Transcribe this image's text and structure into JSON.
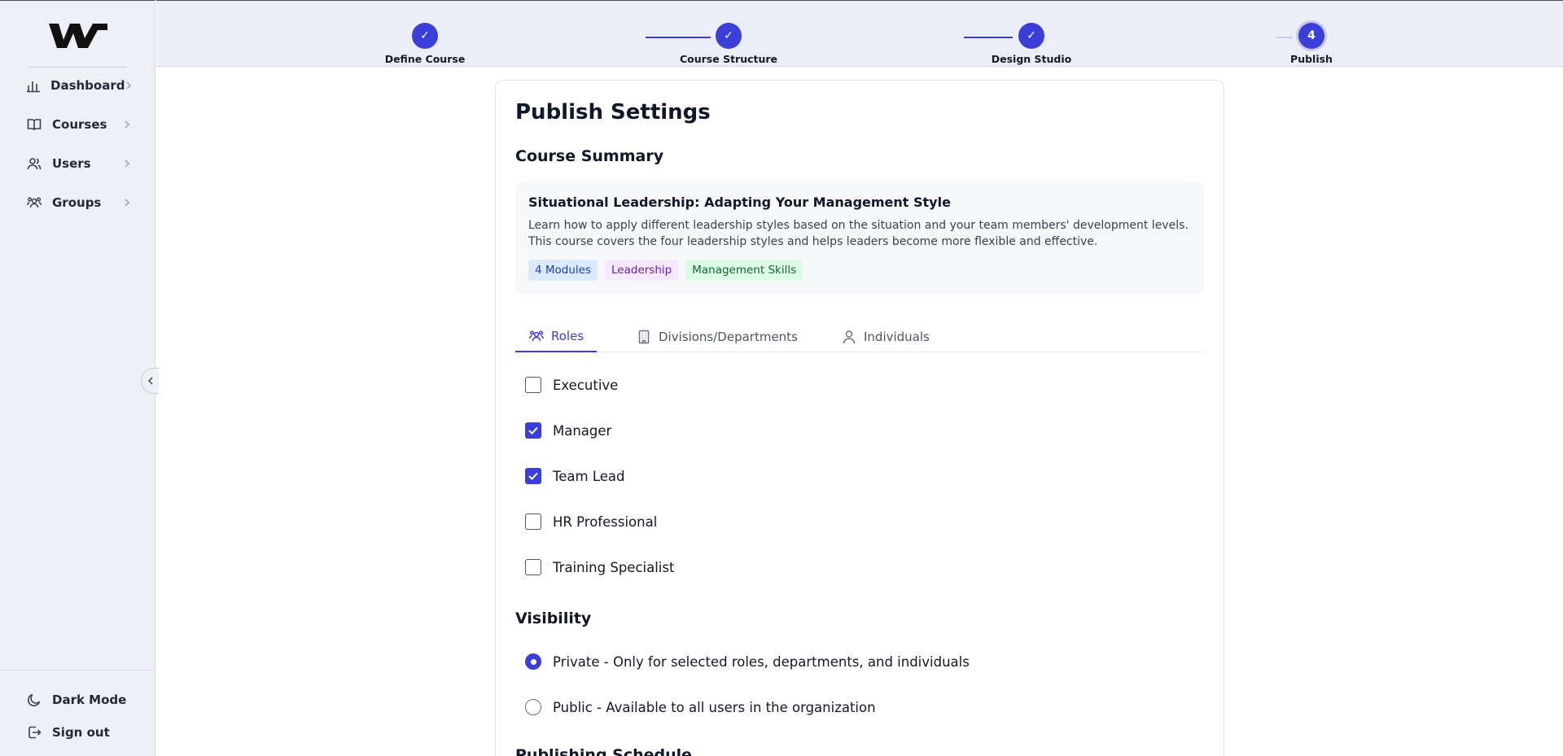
{
  "sidebar": {
    "items": [
      {
        "label": "Dashboard",
        "icon": "bar-chart-icon"
      },
      {
        "label": "Courses",
        "icon": "book-icon"
      },
      {
        "label": "Users",
        "icon": "users-icon"
      },
      {
        "label": "Groups",
        "icon": "groups-icon"
      }
    ],
    "bottom": {
      "dark_mode": "Dark Mode",
      "sign_out": "Sign out"
    }
  },
  "stepper": {
    "steps": [
      {
        "label": "Define Course",
        "mark": "✓"
      },
      {
        "label": "Course Structure",
        "mark": "✓"
      },
      {
        "label": "Design Studio",
        "mark": "✓"
      },
      {
        "label": "Publish",
        "mark": "4"
      }
    ],
    "accent": "#3b3fd8"
  },
  "page": {
    "title": "Publish Settings",
    "summary_heading": "Course Summary",
    "course": {
      "title": "Situational Leadership: Adapting Your Management Style",
      "description": "Learn how to apply different leadership styles based on the situation and your team members' development levels. This course covers the four leadership styles and helps leaders become more flexible and effective.",
      "tags": [
        "4 Modules",
        "Leadership",
        "Management Skills"
      ]
    },
    "tabs": [
      "Roles",
      "Divisions/Departments",
      "Individuals"
    ],
    "roles": [
      {
        "label": "Executive",
        "checked": false
      },
      {
        "label": "Manager",
        "checked": true
      },
      {
        "label": "Team Lead",
        "checked": true
      },
      {
        "label": "HR Professional",
        "checked": false
      },
      {
        "label": "Training Specialist",
        "checked": false
      }
    ],
    "visibility_heading": "Visibility",
    "visibility_options": [
      {
        "label": "Private - Only for selected roles, departments, and individuals",
        "checked": true
      },
      {
        "label": "Public - Available to all users in the organization",
        "checked": false
      }
    ],
    "schedule_heading": "Publishing Schedule"
  }
}
